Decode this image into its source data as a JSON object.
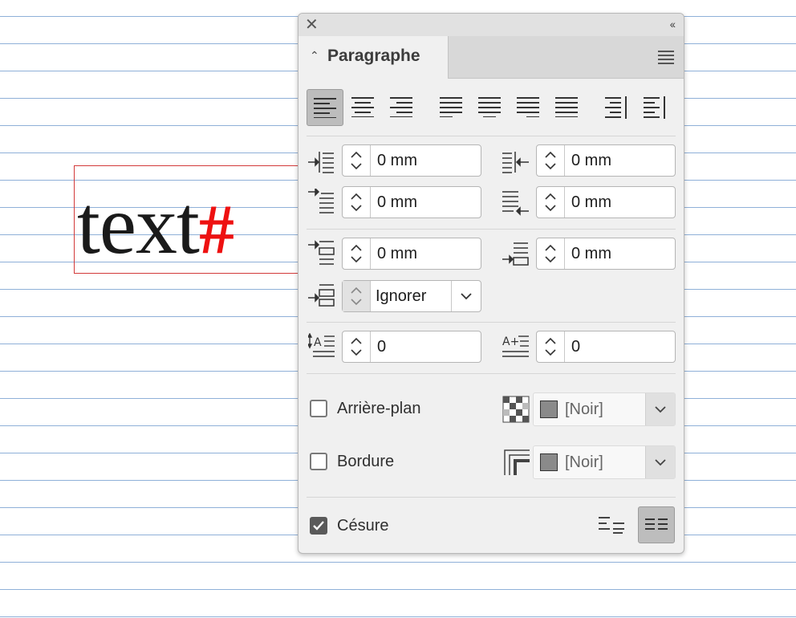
{
  "document": {
    "sample_text": "text",
    "hidden_char": "#"
  },
  "panel": {
    "title": "Paragraphe",
    "close_icon": "close-icon",
    "collapse_icon": "double-chevron-left-icon",
    "menu_icon": "panel-menu-icon"
  },
  "alignment": {
    "buttons": [
      {
        "name": "align-left",
        "selected": true
      },
      {
        "name": "align-center",
        "selected": false
      },
      {
        "name": "align-right",
        "selected": false
      },
      {
        "name": "justify-last-left",
        "selected": false
      },
      {
        "name": "justify-last-center",
        "selected": false
      },
      {
        "name": "justify-last-right",
        "selected": false
      },
      {
        "name": "justify-all",
        "selected": false
      },
      {
        "name": "align-towards-spine",
        "selected": false
      },
      {
        "name": "align-away-from-spine",
        "selected": false
      }
    ]
  },
  "indents": {
    "left": "0 mm",
    "right": "0 mm",
    "first_line": "0 mm",
    "last_line": "0 mm"
  },
  "spacing": {
    "before": "0 mm",
    "after": "0 mm",
    "between": "Ignorer"
  },
  "drop_cap": {
    "lines": "0",
    "characters": "0"
  },
  "shading": {
    "label": "Arrière-plan",
    "checked": false,
    "color": "[Noir]"
  },
  "border": {
    "label": "Bordure",
    "checked": false,
    "color": "[Noir]"
  },
  "hyphenation": {
    "label": "Césure",
    "checked": true
  }
}
